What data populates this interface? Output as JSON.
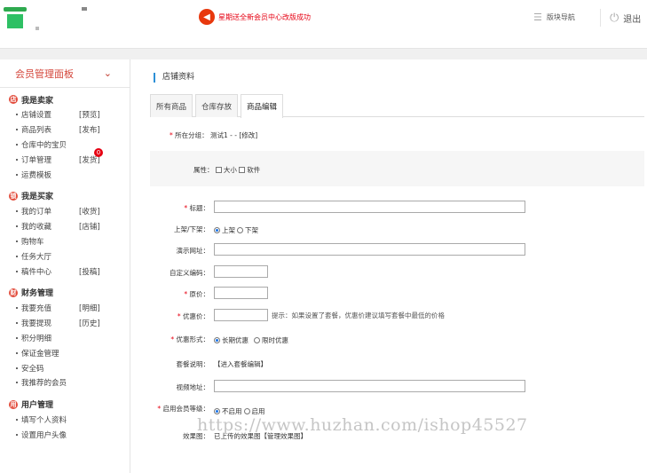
{
  "header": {
    "notice": "星期送全新会员中心改版成功",
    "nav_label": "版块导航",
    "exit_label": "退出"
  },
  "sidebar": {
    "title": "会员管理面板",
    "groups": [
      {
        "title": "我是卖家",
        "items": [
          {
            "label": "店铺设置",
            "tag": "[预览]"
          },
          {
            "label": "商品列表",
            "tag": "[发布]"
          },
          {
            "label": "仓库中的宝贝",
            "tag": ""
          },
          {
            "label": "订单管理",
            "tag": "[发货]",
            "badge": "0"
          },
          {
            "label": "运费模板",
            "tag": ""
          }
        ]
      },
      {
        "title": "我是买家",
        "items": [
          {
            "label": "我的订单",
            "tag": "[收货]"
          },
          {
            "label": "我的收藏",
            "tag": "[店铺]"
          },
          {
            "label": "购物车",
            "tag": ""
          },
          {
            "label": "任务大厅",
            "tag": ""
          },
          {
            "label": "稿件中心",
            "tag": "[投稿]"
          }
        ]
      },
      {
        "title": "财务管理",
        "items": [
          {
            "label": "我要充值",
            "tag": "[明细]"
          },
          {
            "label": "我要提现",
            "tag": "[历史]"
          },
          {
            "label": "积分明细",
            "tag": ""
          },
          {
            "label": "保证金管理",
            "tag": ""
          },
          {
            "label": "安全码",
            "tag": ""
          },
          {
            "label": "我推荐的会员",
            "tag": ""
          }
        ]
      },
      {
        "title": "用户管理",
        "items": [
          {
            "label": "填写个人资料",
            "tag": ""
          },
          {
            "label": "设置用户头像",
            "tag": ""
          }
        ]
      }
    ]
  },
  "main": {
    "title": "店铺资料",
    "tabs": [
      "所有商品",
      "仓库存放",
      "商品编辑"
    ],
    "active_tab": "商品编辑",
    "form": {
      "category_label": "所在分组：",
      "category_value": "测试1 - - [修改]",
      "attr_label": "属性：",
      "attr_opt1": "大小",
      "attr_opt2": "软件",
      "title_label": "标题：",
      "listing_label": "上架/下架：",
      "listing_opt1": "上架",
      "listing_opt2": "下架",
      "demo_label": "演示网址：",
      "code_label": "自定义编码：",
      "price_label": "原价：",
      "promo_label": "优惠价：",
      "promo_hint": "提示：如果设置了套餐，优惠价建议填写套餐中最低的价格",
      "promo_form_label": "优惠形式：",
      "promo_form_opt1": "长期优惠",
      "promo_form_opt2": "限时优惠",
      "package_label": "套餐说明：",
      "package_value": "【进入套餐编辑】",
      "video_label": "视频地址：",
      "member_level_label": "启用会员等级：",
      "member_opt1": "不启用",
      "member_opt2": "启用",
      "effect_label": "效果图：",
      "effect_value": "已上传的效果图【管理效果图】"
    }
  },
  "watermark": "https://www.huzhan.com/ishop45527"
}
